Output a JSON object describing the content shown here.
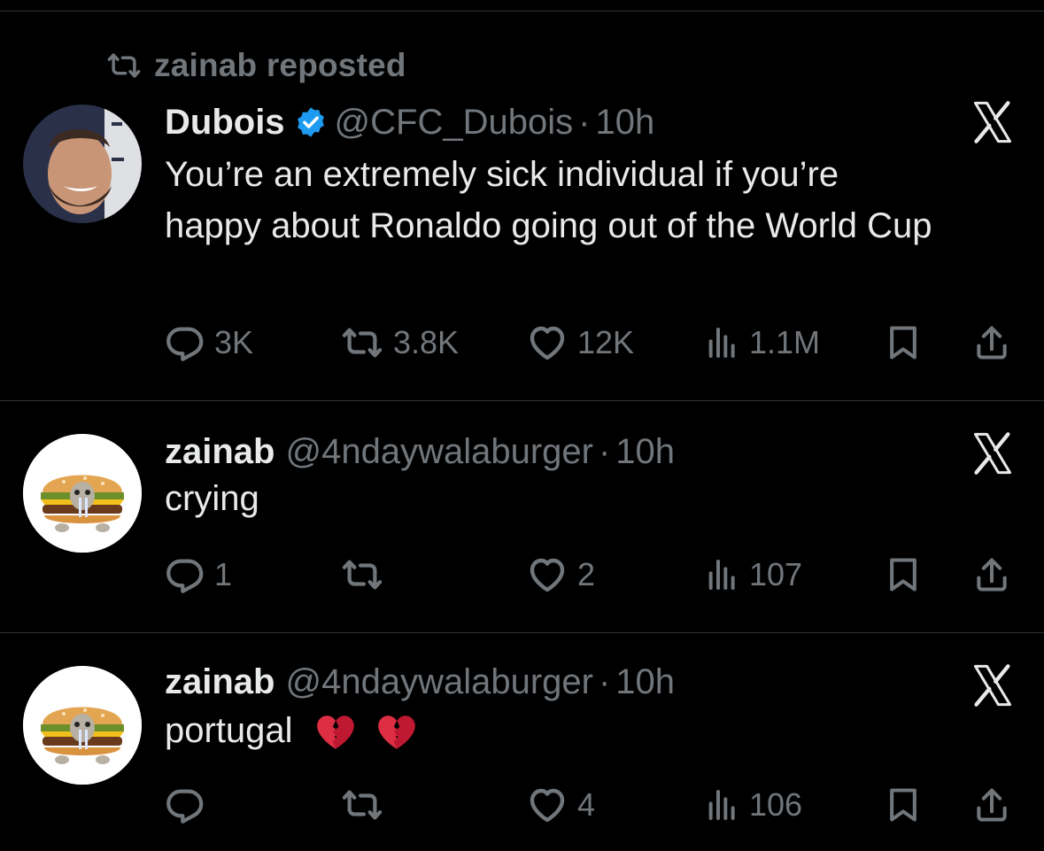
{
  "repost_banner": {
    "icon": "repost-icon",
    "text": "zainab reposted"
  },
  "tweets": [
    {
      "name": "Dubois",
      "verified": true,
      "handle": "@CFC_Dubois",
      "separator": "·",
      "time": "10h",
      "text": "You’re an extremely sick individual if you’re happy about Ronaldo going out of the World Cup",
      "stats": {
        "replies": "3K",
        "reposts": "3.8K",
        "likes": "12K",
        "views": "1.1M"
      }
    },
    {
      "name": "zainab",
      "handle": "@4ndaywalaburger",
      "separator": "·",
      "time": "10h",
      "text": "crying",
      "stats": {
        "replies": "1",
        "reposts": "",
        "likes": "2",
        "views": "107"
      }
    },
    {
      "name": "zainab",
      "handle": "@4ndaywalaburger",
      "separator": "·",
      "time": "10h",
      "text": "portugal",
      "emoji": [
        "broken-heart-icon",
        "broken-heart-icon"
      ],
      "stats": {
        "replies": "",
        "reposts": "",
        "likes": "4",
        "views": "106"
      }
    }
  ],
  "colors": {
    "background": "#000000",
    "text": "#e7e9ea",
    "muted": "#71767b",
    "verified": "#1d9bf0",
    "divider": "#2f3336"
  }
}
